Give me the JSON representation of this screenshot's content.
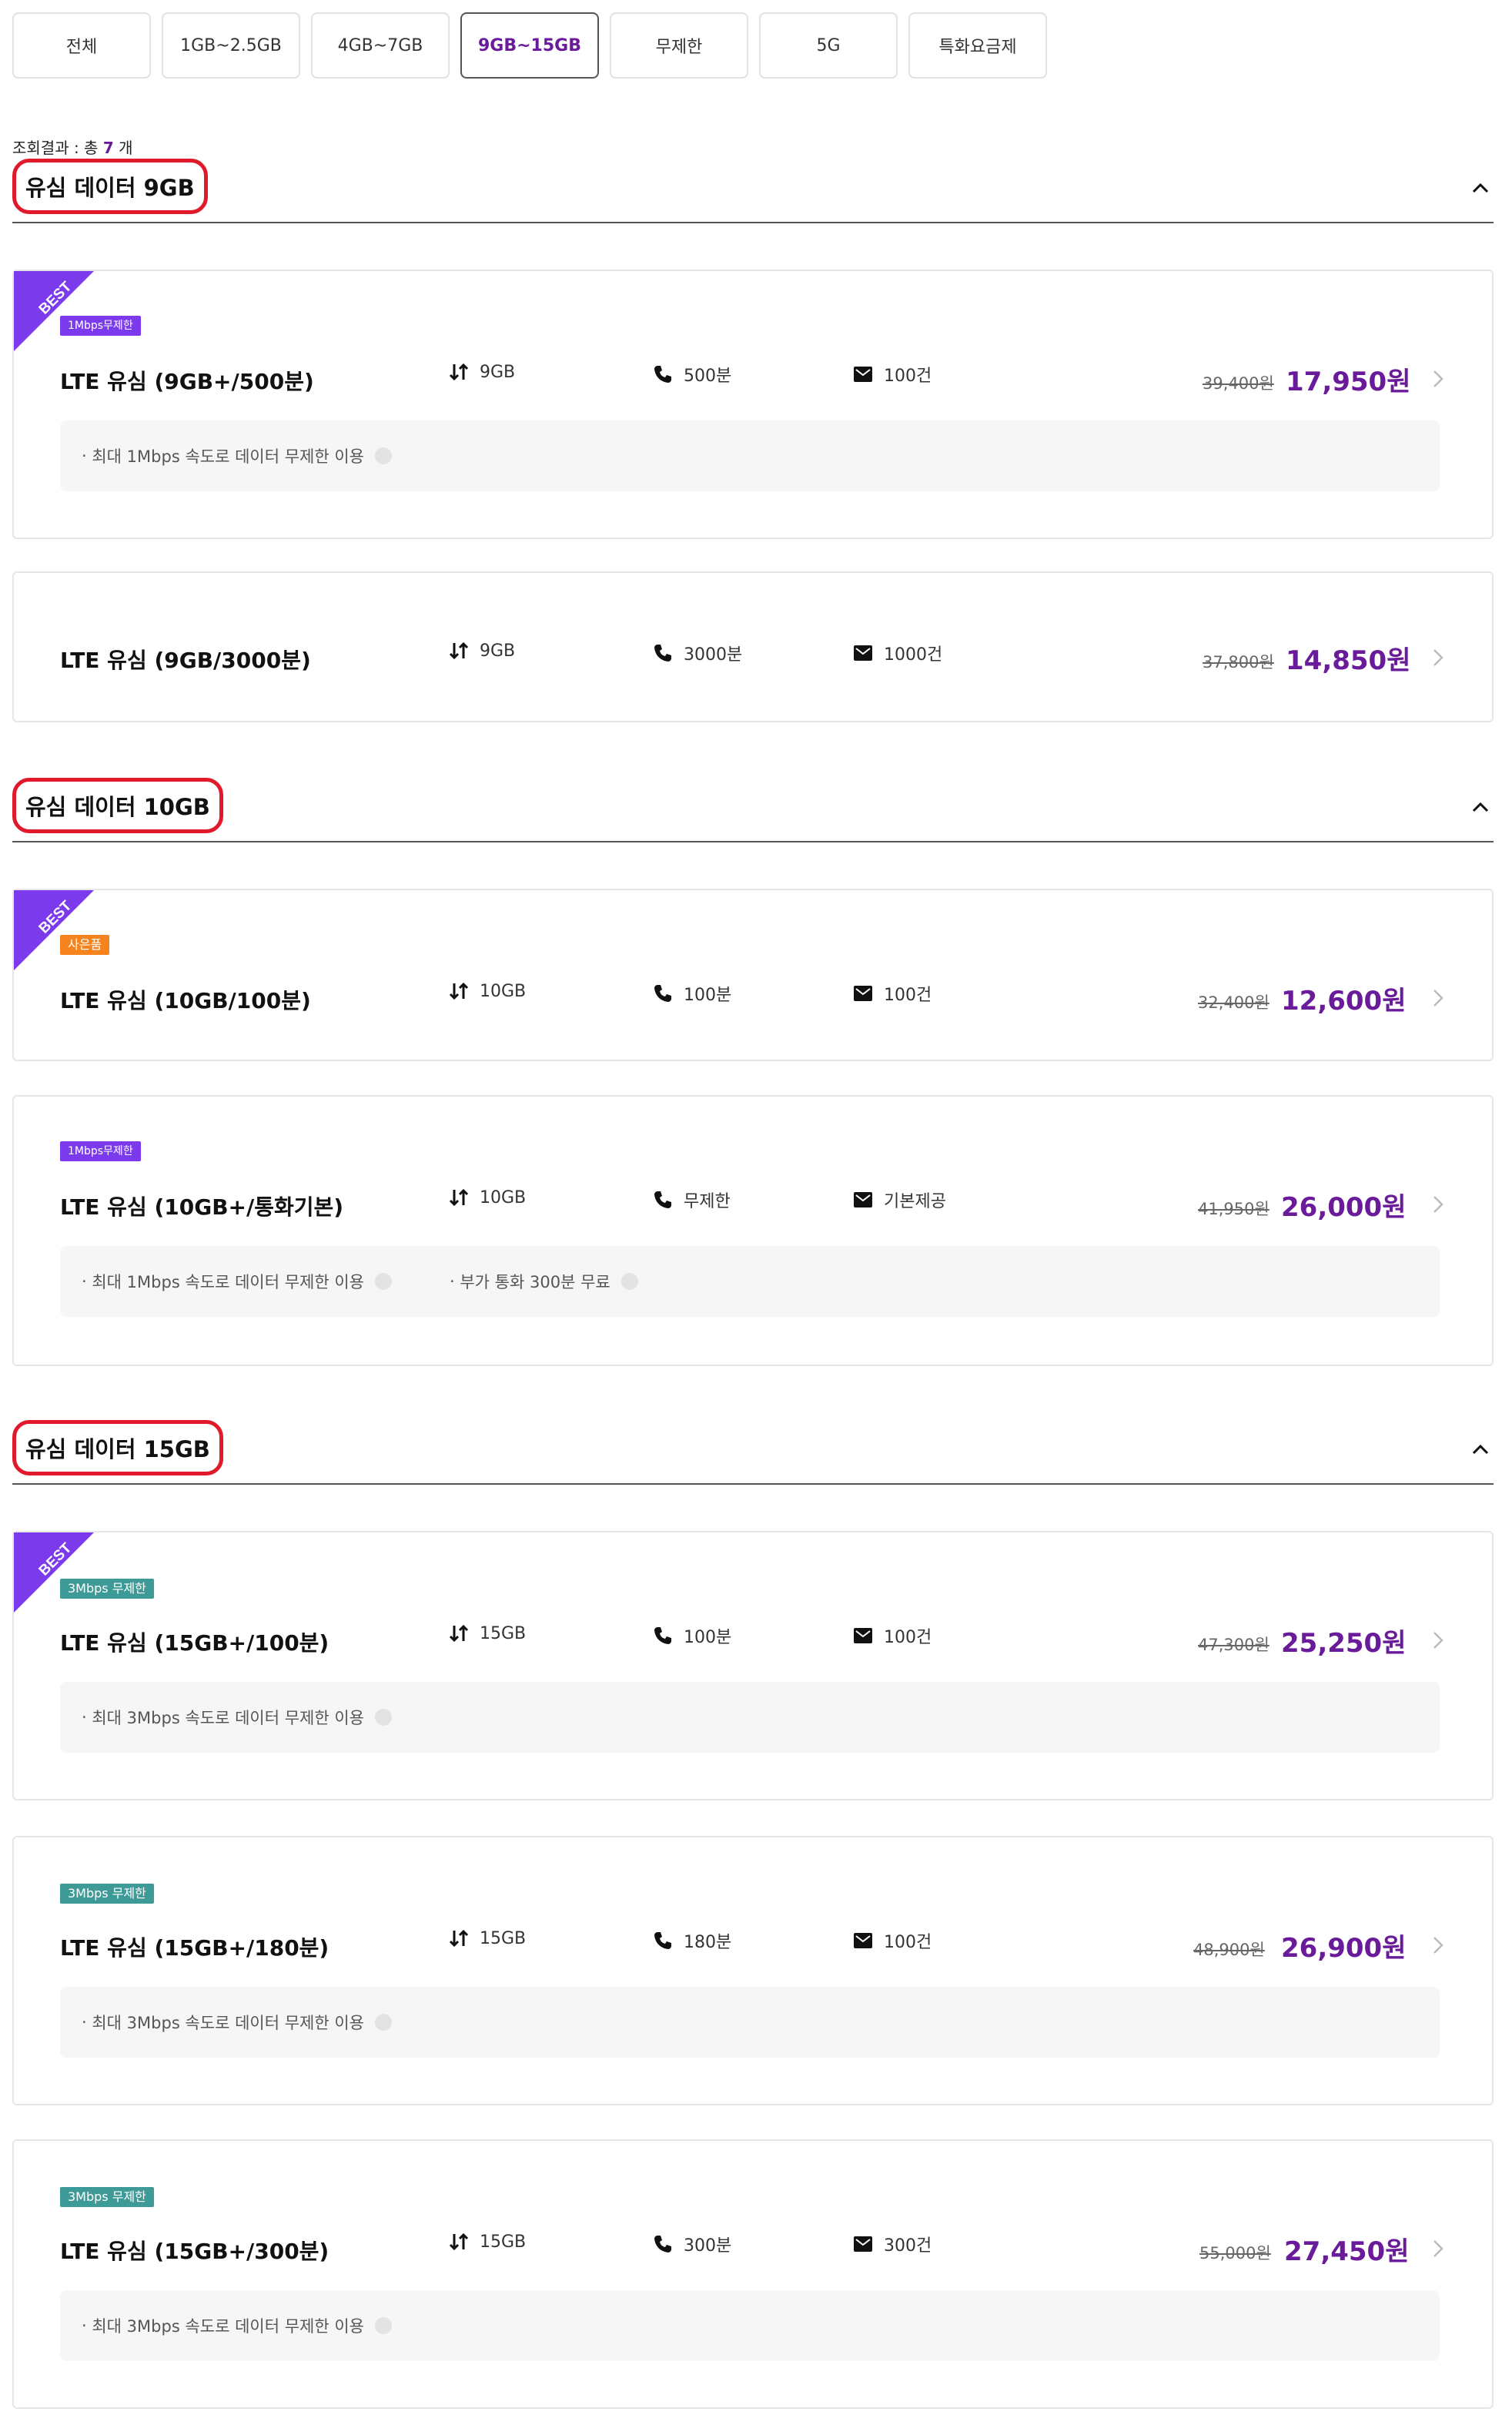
{
  "tabs": [
    "전체",
    "1GB~2.5GB",
    "4GB~7GB",
    "9GB~15GB",
    "무제한",
    "5G",
    "특화요금제"
  ],
  "result": {
    "label": "조회결과 : 총 ",
    "count": "7",
    "unit": " 개"
  },
  "sections": [
    {
      "title": "유심 데이터 9GB"
    },
    {
      "title": "유심 데이터 10GB"
    },
    {
      "title": "유심 데이터 15GB"
    }
  ],
  "best_label": "BEST",
  "plans": [
    {
      "name": "LTE 유심 (9GB+/500분)",
      "badge": "1Mbps무제한",
      "data": "9GB",
      "voice": "500분",
      "sms": "100건",
      "original_price": "39,400원",
      "price": "17,950원",
      "descriptions": [
        "최대 1Mbps 속도로 데이터 무제한 이용"
      ]
    },
    {
      "name": "LTE 유심 (9GB/3000분)",
      "data": "9GB",
      "voice": "3000분",
      "sms": "1000건",
      "original_price": "37,800원",
      "price": "14,850원"
    },
    {
      "name": "LTE 유심 (10GB/100분)",
      "badge": "사은품",
      "data": "10GB",
      "voice": "100분",
      "sms": "100건",
      "original_price": "32,400원",
      "price": "12,600원"
    },
    {
      "name": "LTE 유심 (10GB+/통화기본)",
      "badge": "1Mbps무제한",
      "data": "10GB",
      "voice": "무제한",
      "sms": "기본제공",
      "original_price": "41,950원",
      "price": "26,000원",
      "descriptions": [
        "최대 1Mbps 속도로 데이터 무제한 이용",
        "부가 통화 300분 무료"
      ]
    },
    {
      "name": "LTE 유심 (15GB+/100분)",
      "badge": "3Mbps 무제한",
      "data": "15GB",
      "voice": "100분",
      "sms": "100건",
      "original_price": "47,300원",
      "price": "25,250원",
      "descriptions": [
        "최대 3Mbps 속도로 데이터 무제한 이용"
      ]
    },
    {
      "name": "LTE 유심 (15GB+/180분)",
      "badge": "3Mbps 무제한",
      "data": "15GB",
      "voice": "180분",
      "sms": "100건",
      "original_price": "48,900원",
      "price": "26,900원",
      "descriptions": [
        "최대 3Mbps 속도로 데이터 무제한 이용"
      ]
    },
    {
      "name": "LTE 유심 (15GB+/300분)",
      "badge": "3Mbps 무제한",
      "data": "15GB",
      "voice": "300분",
      "sms": "300건",
      "original_price": "55,000원",
      "price": "27,450원",
      "descriptions": [
        "최대 3Mbps 속도로 데이터 무제한 이용"
      ]
    }
  ],
  "colors": {
    "accent": "#6a1b9a",
    "best_ribbon": "#7c3aed",
    "highlight_box": "#e0192b"
  }
}
